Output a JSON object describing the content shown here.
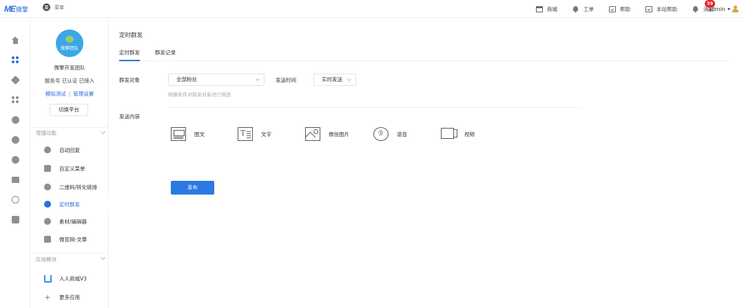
{
  "header": {
    "logo_mark": "ME",
    "logo_text": "微擎",
    "menu_label": "菜单",
    "nav": [
      {
        "label": "商城",
        "icon": "shop-icon"
      },
      {
        "label": "工单",
        "icon": "bell-icon"
      },
      {
        "label": "帮助",
        "icon": "help-box-icon"
      },
      {
        "label": "本站帮助",
        "icon": "help-box-icon"
      },
      {
        "label": "消息",
        "icon": "bell-icon",
        "badge": "39"
      }
    ],
    "user": "admin"
  },
  "icon_rail": [
    {
      "name": "home",
      "active": false
    },
    {
      "name": "apps",
      "active": true
    },
    {
      "name": "cube",
      "active": false
    },
    {
      "name": "modules",
      "active": false
    },
    {
      "name": "cloud",
      "active": false
    },
    {
      "name": "users",
      "active": false
    },
    {
      "name": "user-settings",
      "active": false
    },
    {
      "name": "monitor",
      "active": false
    },
    {
      "name": "globe",
      "active": false
    },
    {
      "name": "store",
      "active": false
    }
  ],
  "sidebar": {
    "avatar_text": "微擎团队",
    "account_name": "微擎开发团队",
    "account_status": "服务号 已认证 已接入",
    "link_test": "模拟测试",
    "link_sep": "|",
    "link_manage": "管理设置",
    "switch_label": "切换平台",
    "section_enhance": "增强功能",
    "enhance_items": [
      {
        "label": "自动回复"
      },
      {
        "label": "自定义菜单"
      },
      {
        "label": "二维码/转化链接"
      },
      {
        "label": "定时群发"
      },
      {
        "label": "素材/编辑器"
      },
      {
        "label": "微官网-文章"
      }
    ],
    "active_item": "定时群发",
    "section_apps": "应用模块",
    "app_items": [
      {
        "label": "人人商城V3"
      },
      {
        "label": "更多应用"
      }
    ]
  },
  "main": {
    "title": "定时群发",
    "tabs": [
      {
        "label": "定时群发",
        "active": true
      },
      {
        "label": "群发记录",
        "active": false
      }
    ],
    "target_label": "群发对象",
    "target_value": "全部粉丝",
    "time_label": "发送时间",
    "time_value": "实时发送",
    "hint": "根据条件对群发对象进行筛选",
    "content_label": "发送内容",
    "content_types": [
      {
        "label": "图文",
        "icon": "news-icon"
      },
      {
        "label": "文字",
        "icon": "text-icon"
      },
      {
        "label": "微信图片",
        "icon": "image-icon"
      },
      {
        "label": "语音",
        "icon": "voice-icon"
      },
      {
        "label": "视频",
        "icon": "video-icon"
      }
    ],
    "publish_label": "发布"
  },
  "colors": {
    "accent": "#2a6fdb",
    "button": "#2a7ae2",
    "badge": "#e8242b"
  }
}
